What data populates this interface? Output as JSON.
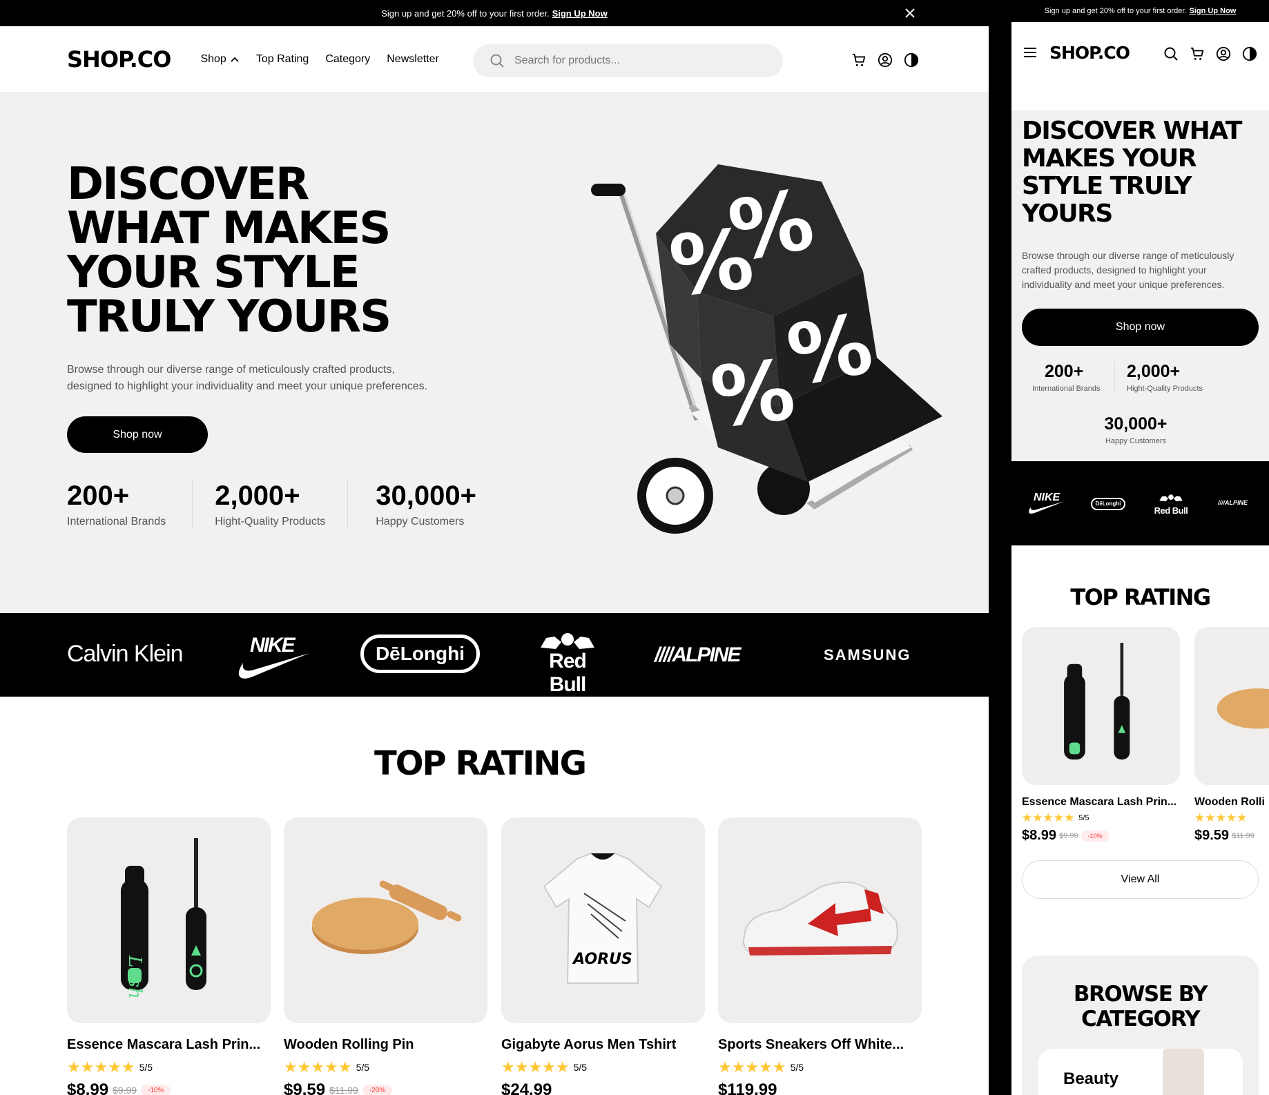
{
  "promo": {
    "text": "Sign up and get 20% off to your first order.",
    "link": "Sign Up Now"
  },
  "brand": "SHOP.CO",
  "nav": [
    {
      "label": "Shop"
    },
    {
      "label": "Top Rating"
    },
    {
      "label": "Category"
    },
    {
      "label": "Newsletter"
    }
  ],
  "search": {
    "placeholder": "Search for products..."
  },
  "hero": {
    "title": "DISCOVER WHAT MAKES YOUR STYLE TRULY YOURS",
    "desc_line1": "Browse through our diverse range of meticulously crafted products,",
    "desc_line2": "designed to highlight your individuality and meet your unique preferences.",
    "cta": "Shop now"
  },
  "mobile_hero": {
    "title": "DISCOVER WHAT MAKES YOUR STYLE TRULY YOURS",
    "desc": "Browse through our diverse range of meticulously crafted products, designed to highlight your individuality and meet your unique preferences."
  },
  "stats": [
    {
      "value": "200+",
      "label": "International Brands"
    },
    {
      "value": "2,000+",
      "label": "Hight-Quality Products"
    },
    {
      "value": "30,000+",
      "label": "Happy Customers"
    }
  ],
  "brands": [
    "Calvin Klein",
    "NIKE",
    "DēLonghi",
    "Red Bull",
    "ALPINE",
    "SAMSUNG"
  ],
  "top_rating": {
    "title": "TOP RATING",
    "view_all": "View All"
  },
  "products": [
    {
      "name": "Essence Mascara Lash Prin...",
      "rating": "5/5",
      "price": "$8.99",
      "old_price": "$9.99",
      "discount": "-10%"
    },
    {
      "name": "Wooden Rolling Pin",
      "rating": "5/5",
      "price": "$9.59",
      "old_price": "$11.99",
      "discount": "-20%"
    },
    {
      "name": "Gigabyte Aorus Men Tshirt",
      "rating": "5/5",
      "price": "$24.99"
    },
    {
      "name": "Sports Sneakers Off White...",
      "rating": "5/5",
      "price": "$119.99"
    }
  ],
  "mobile_products": [
    {
      "name": "Essence Mascara Lash Prin...",
      "rating": "5/5",
      "price": "$8.99",
      "old_price": "$9.99",
      "discount": "-10%"
    },
    {
      "name": "Wooden Rolli",
      "price": "$9.59",
      "old_price": "$11.99"
    }
  ],
  "category": {
    "title_line1": "BROWSE BY",
    "title_line2": "CATEGORY",
    "first": "Beauty"
  },
  "tshirt_print": "AORUS",
  "colors": {
    "star": "#ffc633",
    "discount_bg": "#ffebeb",
    "discount_text": "#ff3333",
    "card_bg": "#f0eeed",
    "hero_bg": "#f2f0f1"
  }
}
